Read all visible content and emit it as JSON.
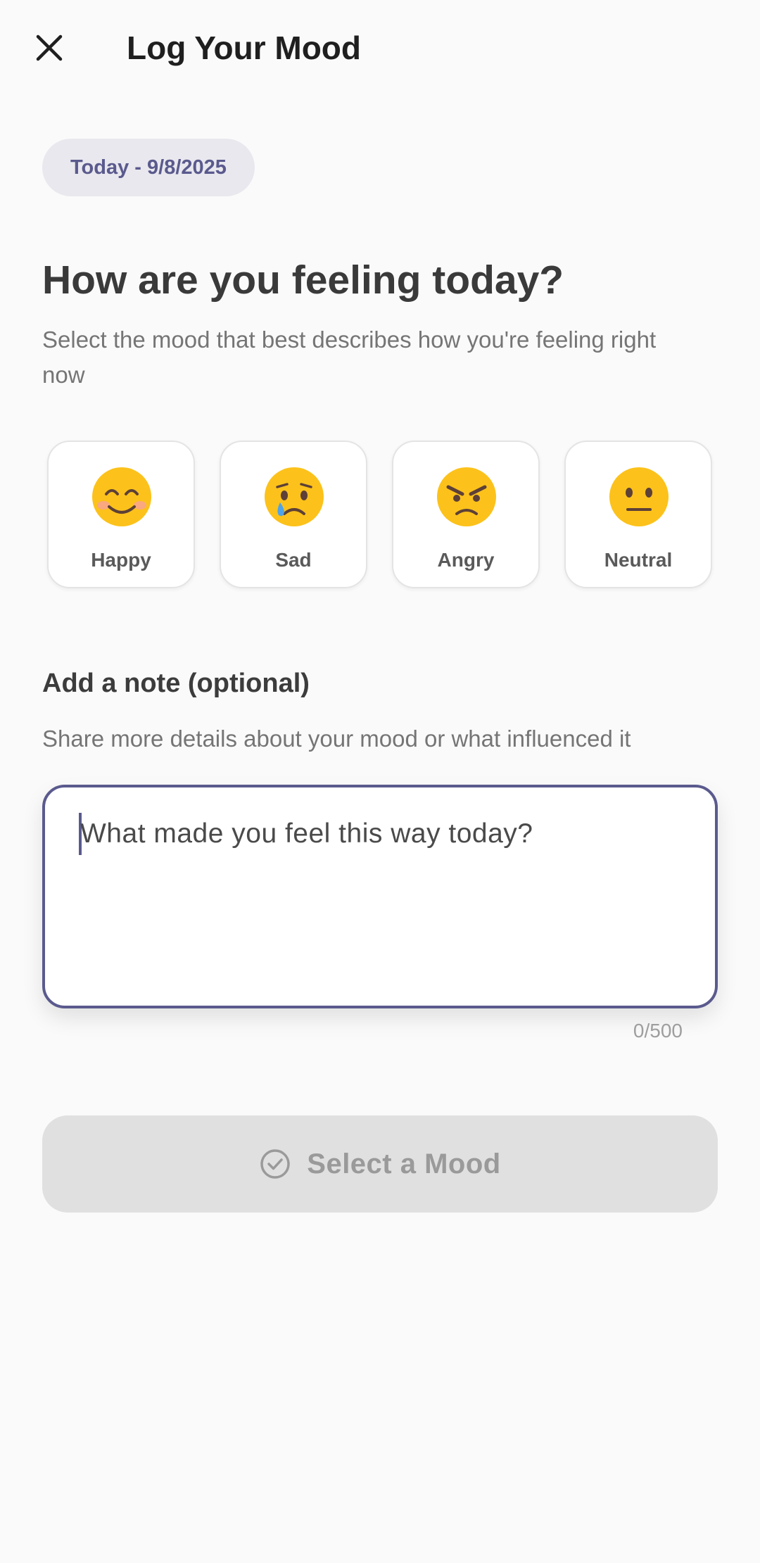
{
  "app_bar": {
    "title": "Log Your Mood",
    "close_icon": "close-icon"
  },
  "date_chip": "Today - 9/8/2025",
  "headline": "How are you feeling today?",
  "subtitle": "Select the mood that best describes how you're feeling right now",
  "moods": [
    {
      "label": "Happy",
      "icon": "smiling-face-icon"
    },
    {
      "label": "Sad",
      "icon": "crying-face-icon"
    },
    {
      "label": "Angry",
      "icon": "angry-face-icon"
    },
    {
      "label": "Neutral",
      "icon": "neutral-face-icon"
    }
  ],
  "note": {
    "title": "Add a note (optional)",
    "description": "Share more details about your mood or what influenced it",
    "value": "",
    "placeholder": "What made you feel this way today?",
    "counter": "0/500"
  },
  "submit_button": {
    "label": "Select a Mood",
    "icon": "check-circle-icon",
    "enabled": false
  },
  "colors": {
    "background": "#fafafa",
    "accent": "#5a5a8e",
    "chip_background": "#e9e8ee",
    "disabled_button": "#e0e0e0",
    "emoji_yellow": "#fcc21b"
  }
}
